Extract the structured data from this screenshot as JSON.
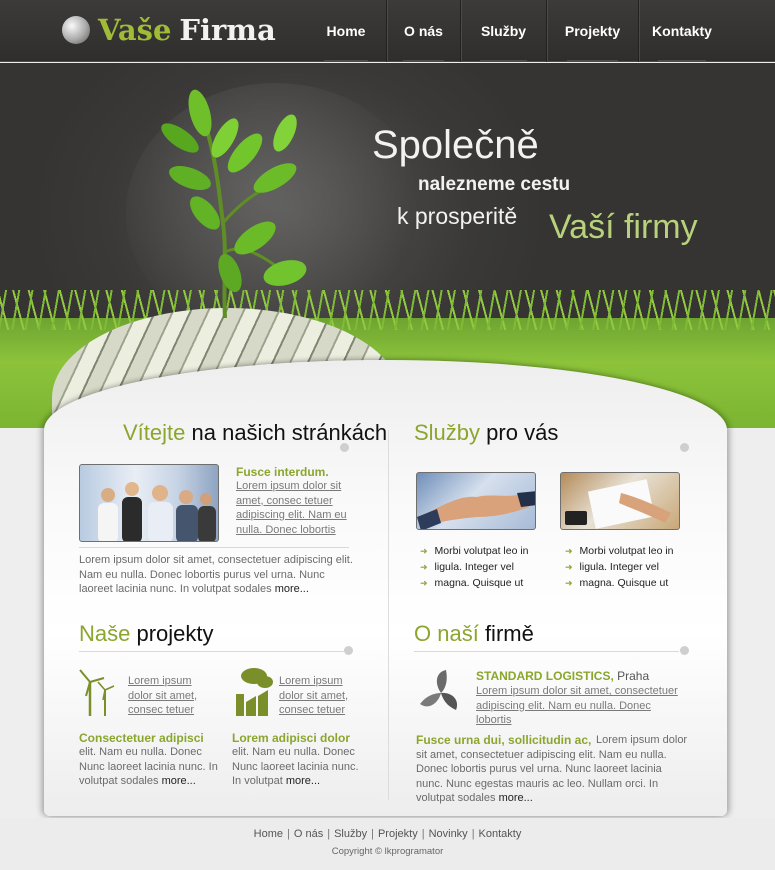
{
  "logo": {
    "word1": "Vaše",
    "word2": "Firma"
  },
  "nav": [
    {
      "label": "Home"
    },
    {
      "label": "O nás"
    },
    {
      "label": "Služby"
    },
    {
      "label": "Projekty"
    },
    {
      "label": "Kontakty"
    }
  ],
  "hero": {
    "line1": "Společně",
    "line2": "nalezneme cestu",
    "line3": "k prosperitě",
    "line4": "Vaší firmy"
  },
  "welcome": {
    "title_green": "Vítejte",
    "title_rest": "na našich stránkách",
    "aside_head": "Fusce interdum.",
    "aside_link": "Lorem ipsum dolor sit amet, consec tetuer adipiscing elit. Nam eu nulla. Donec lobortis",
    "text": "Lorem ipsum dolor sit amet, consectetuer adipiscing elit. Nam eu nulla. Donec lobortis purus vel urna. Nunc laoreet lacinia nunc. In volutpat sodales",
    "more": "more..."
  },
  "services": {
    "title_green": "Služby",
    "title_rest": "pro vás",
    "list1": [
      "Morbi volutpat leo in",
      "ligula. Integer vel",
      "magna. Quisque ut"
    ],
    "list2": [
      "Morbi volutpat leo in",
      "ligula. Integer vel",
      "magna. Quisque ut"
    ]
  },
  "projects": {
    "title_green": "Naše",
    "title_rest": "projekty",
    "items": [
      {
        "link": "Lorem ipsum dolor sit amet, consec tetuer",
        "head": "Consectetuer adipisci",
        "text": "elit. Nam eu nulla. Donec Nunc laoreet lacinia nunc. In volutpat sodales",
        "more": "more..."
      },
      {
        "link": "Lorem ipsum dolor sit amet, consec tetuer",
        "head": "Lorem adipisci dolor",
        "text": "elit. Nam eu nulla. Donec Nunc laoreet lacinia nunc. In volutpat",
        "more": "more..."
      }
    ]
  },
  "about": {
    "title_green": "O naší",
    "title_rest": "firmě",
    "company_green": "STANDARD LOGISTICS,",
    "company_city": "Praha",
    "company_link": "Lorem ipsum dolor sit amet, consectetuer adipiscing elit. Nam eu nulla. Donec lobortis",
    "head": "Fusce urna dui, sollicitudin ac,",
    "text": "Lorem ipsum dolor sit amet, consectetuer adipiscing elit. Nam eu nulla. Donec lobortis purus vel urna. Nunc laoreet lacinia nunc. Nunc egestas mauris ac leo. Nullam orci. In volutpat sodales",
    "more": "more..."
  },
  "footer": {
    "links": [
      "Home",
      "O nás",
      "Služby",
      "Projekty",
      "Novinky",
      "Kontakty"
    ],
    "copyright": "Copyright © lkprogramator"
  },
  "colors": {
    "accent": "#8aa62e",
    "header_bg": "#333231",
    "hero_slogan_accent": "#b8d27b"
  }
}
